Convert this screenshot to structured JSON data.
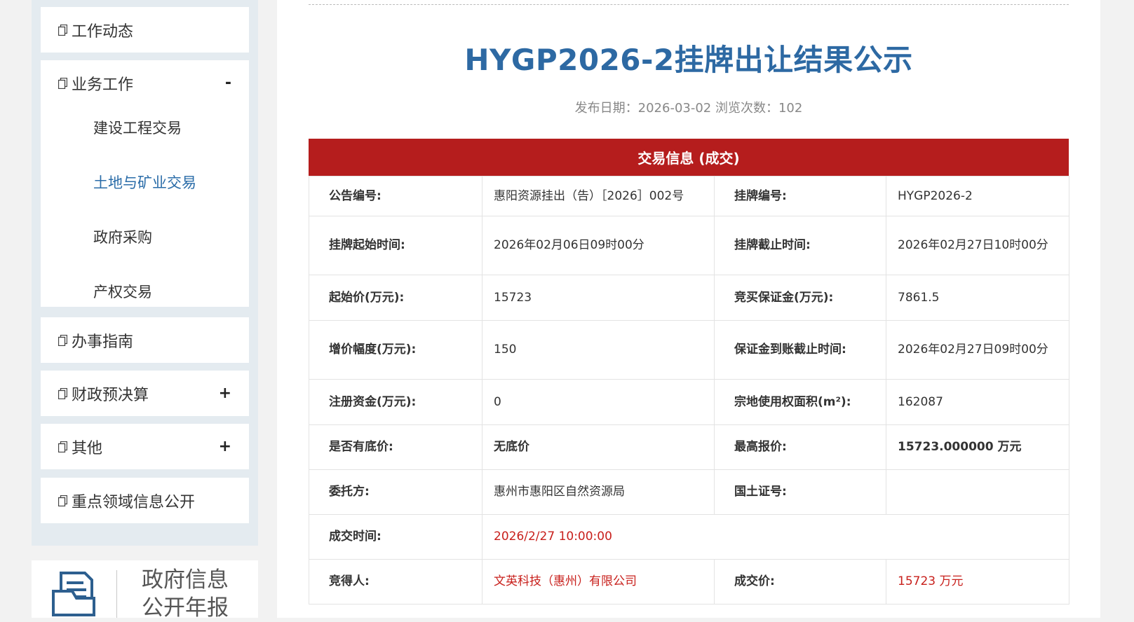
{
  "sidebar": {
    "menu": [
      {
        "label": "工作动态"
      },
      {
        "label": "业务工作",
        "toggle": "-",
        "children": [
          {
            "label": "建设工程交易",
            "active": false
          },
          {
            "label": "土地与矿业交易",
            "active": true
          },
          {
            "label": "政府采购",
            "active": false
          },
          {
            "label": "产权交易",
            "active": false
          }
        ]
      },
      {
        "label": "办事指南"
      },
      {
        "label": "财政预决算",
        "toggle": "+"
      },
      {
        "label": "其他",
        "toggle": "+"
      },
      {
        "label": "重点领域信息公开"
      }
    ],
    "report": {
      "line1": "政府信息",
      "line2": "公开年报"
    }
  },
  "article": {
    "title": "HYGP2026-2挂牌出让结果公示",
    "publish_label": "发布日期：",
    "publish_date": "2026-03-02",
    "views_label": "浏览次数：",
    "views": "102"
  },
  "info": {
    "banner": "交易信息 (成交)",
    "rows": [
      [
        {
          "label": "公告编号:",
          "value": "惠阳资源挂出（告）［2026］002号"
        },
        {
          "label": "挂牌编号:",
          "value": "HYGP2026-2"
        }
      ],
      [
        {
          "label": "挂牌起始时间:",
          "value": "2026年02月06日09时00分"
        },
        {
          "label": "挂牌截止时间:",
          "value": "2026年02月27日10时00分"
        }
      ],
      [
        {
          "label": "起始价(万元):",
          "value": "15723"
        },
        {
          "label": "竞买保证金(万元):",
          "value": "7861.5"
        }
      ],
      [
        {
          "label": "增价幅度(万元):",
          "value": "150"
        },
        {
          "label": "保证金到账截止时间:",
          "value": "2026年02月27日09时00分"
        }
      ],
      [
        {
          "label": "注册资金(万元):",
          "value": "0"
        },
        {
          "label": "宗地使用权面积(m²):",
          "value": "162087"
        }
      ],
      [
        {
          "label": "是否有底价:",
          "value": "无底价"
        },
        {
          "label": "最高报价:",
          "value": "15723.000000 万元"
        }
      ],
      [
        {
          "label": "委托方:",
          "value": "惠州市惠阳区自然资源局"
        },
        {
          "label": "国土证号:",
          "value": ""
        }
      ],
      [
        {
          "label": "成交时间:",
          "value": "2026/2/27 10:00:00"
        }
      ],
      [
        {
          "label": "竞得人:",
          "value": "文英科技（惠州）有限公司"
        },
        {
          "label": "成交价:",
          "value": "15723 万元"
        }
      ]
    ]
  },
  "colors": {
    "title": "#2d69a3",
    "banner": "#b51d1d",
    "highlight_red": "#c8201c",
    "active_link": "#2a6ca8"
  }
}
